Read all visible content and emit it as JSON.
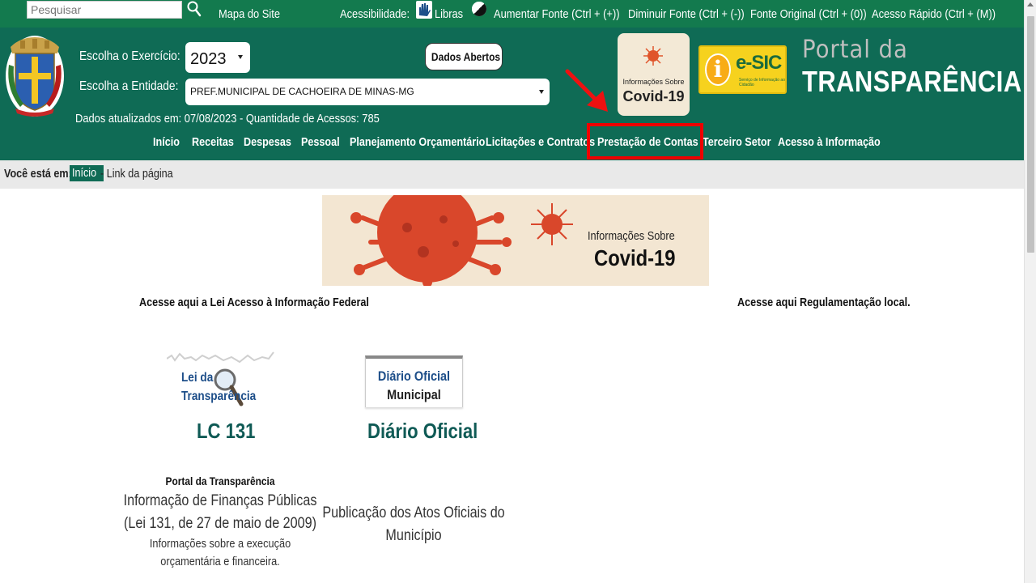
{
  "topbar": {
    "search_placeholder": "Pesquisar",
    "site_map": "Mapa do Site",
    "accessibility_label": "Acessibilidade:",
    "libras": "Libras",
    "increase_font": "Aumentar Fonte (Ctrl + (+))",
    "decrease_font": "Diminuir Fonte (Ctrl + (-))",
    "original_font": "Fonte Original (Ctrl + (0))",
    "quick_access": "Acesso Rápido (Ctrl + (M))"
  },
  "header": {
    "exercise_label": "Escolha o Exercício:",
    "exercise_value": "2023",
    "entity_label": "Escolha a Entidade:",
    "entity_value": "PREF.MUNICIPAL DE CACHOEIRA DE MINAS-MG",
    "open_data_button": "Dados Abertos",
    "updated_info": "Dados atualizados em: 07/08/2023 - Quantidade de Acessos: 785",
    "covid_small": "Informações Sobre",
    "covid_big": "Covid-19",
    "esic_title": "e-SIC",
    "esic_subtitle": "Serviço de Informação ao Cidadão",
    "portal_line1": "Portal da",
    "portal_line2": "TRANSPARÊNCIA"
  },
  "nav": [
    "Início",
    "Receitas",
    "Despesas",
    "Pessoal",
    "Planejamento Orçamentário",
    "Licitações e Contratos",
    "Prestação de Contas",
    "Terceiro Setor",
    "Acesso à Informação"
  ],
  "breadcrumb": {
    "label": "Você está em:",
    "current": "Início",
    "rest": "- Link da página"
  },
  "banner": {
    "small": "Informações Sobre",
    "big": "Covid-19"
  },
  "sections": {
    "federal": "Acesse aqui a Lei Acesso à Informação Federal",
    "local": "Acesse aqui Regulamentação local."
  },
  "cards": {
    "lc131": {
      "logo_line1": "Lei da",
      "logo_line2": "Transparência",
      "title": "LC 131",
      "desc_bold": "Portal da Transparência",
      "desc_line1": "Informação de Finanças Públicas",
      "desc_line2": "(Lei 131, de 27 de maio de 2009)",
      "desc_line3": "Informações sobre a execução",
      "desc_line4": "orçamentária e financeira."
    },
    "diario": {
      "logo_line1": "Diário Oficial",
      "logo_line2": "Municipal",
      "title": "Diário Oficial",
      "desc_line1": "Publicação dos Atos Oficiais do",
      "desc_line2": "Município"
    }
  },
  "colors": {
    "topbar": "#137a4e",
    "header": "#0f6b55",
    "highlight": "#ee0000"
  }
}
